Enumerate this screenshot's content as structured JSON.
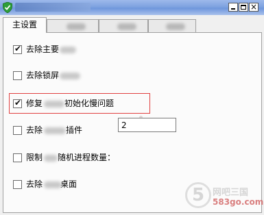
{
  "window": {
    "title": "",
    "controls": {
      "minimize": "_",
      "maximize": "□",
      "close": "×"
    }
  },
  "tabs": [
    {
      "label": "主设置"
    },
    {
      "label": ""
    },
    {
      "label": ""
    },
    {
      "label": ""
    }
  ],
  "options": [
    {
      "label_before": "去除主要",
      "label_after": "",
      "checked": true,
      "check_glyph": "✔"
    },
    {
      "label_before": "去除锁屏",
      "label_after": "",
      "checked": false,
      "check_glyph": ""
    },
    {
      "label_before": "修复",
      "label_after": "初始化慢问题",
      "checked": true,
      "check_glyph": "✔"
    },
    {
      "label_before": "去除",
      "label_after": "插件",
      "checked": false,
      "check_glyph": ""
    },
    {
      "label_before": "限制",
      "label_after": "随机进程数量：",
      "checked": false,
      "check_glyph": ""
    },
    {
      "label_before": "去除",
      "label_after": "桌面",
      "checked": false,
      "check_glyph": ""
    }
  ],
  "process_limit": {
    "value": "2"
  },
  "watermark": {
    "logo": "5",
    "cn": "网吧三国",
    "url": "583go.com"
  },
  "colors": {
    "highlight": "#e04040",
    "titlebar": "#7ea2e0"
  },
  "icons": {
    "app": "shield-icon"
  }
}
